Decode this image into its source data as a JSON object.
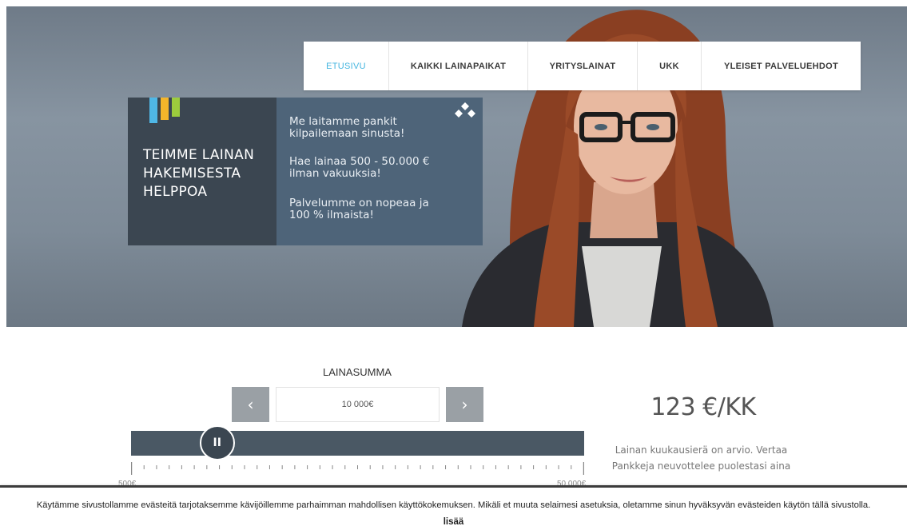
{
  "nav": {
    "items": [
      {
        "label": "ETUSIVU",
        "active": true
      },
      {
        "label": "KAIKKI LAINAPAIKAT",
        "active": false
      },
      {
        "label": "YRITYSLAINAT",
        "active": false
      },
      {
        "label": "UKK",
        "active": false
      },
      {
        "label": "YLEISET PALVELUEHDOT",
        "active": false
      }
    ]
  },
  "hero": {
    "headline": "TEIMME LAINAN\nHAKEMISESTA\nHELPPOA",
    "pitch_lines": [
      "Me laitamme pankit\nkilpailemaan sinusta!",
      "Hae lainaa 500 - 50.000 €\nilman vakuuksia!",
      "Palvelumme on nopeaa ja\n100 % ilmaista!"
    ],
    "bar_colors": [
      "#4fb7e6",
      "#f4b52a",
      "#9ccc3d"
    ]
  },
  "calculator": {
    "title": "LAINASUMMA",
    "prev_label": "‹",
    "next_label": "›",
    "amount_value": "10 000€",
    "slider_level_fraction": 0.19,
    "handle_glyph": "II",
    "range_min": "500€",
    "range_max": "50 000€",
    "monthly_amount": "123 €/KK",
    "monthly_note": "Lainan kuukausierä on arvio. Vertaa Pankkeja neuvottelee puolestasi aina"
  },
  "cookie": {
    "text": "Käytämme sivustollamme evästeitä tarjotaksemme kävijöillemme parhaimman mahdollisen käyttökokemuksen. Mikäli et muuta selaimesi asetuksia, oletamme sinun hyväksyvän evästeiden käytön tällä sivustolla.",
    "more_label": "lisää"
  },
  "colors": {
    "accent": "#46b6e0",
    "dark_panel": "#3b4651",
    "blue_panel": "#4e6479"
  }
}
